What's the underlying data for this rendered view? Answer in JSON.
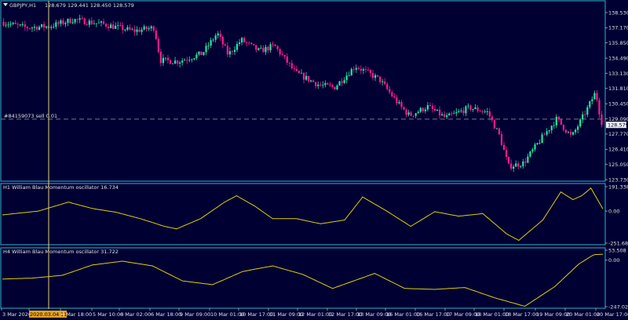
{
  "colors": {
    "background": "#000033",
    "frame": "#2fb3c9",
    "bull": "#26e6a0",
    "bear": "#ff1a8c",
    "text": "#e0e0e0",
    "oscillator": "#e0d000",
    "crosshair": "#e6d27a",
    "price_tag_bg": "#f0f0f0",
    "price_tag_fg": "#000033",
    "date_tag_bg": "#e8a317",
    "order_line": "#7a7a7a"
  },
  "header": {
    "triangle_icon": "triangle-down-icon",
    "symbol": "GBPJPY,H1",
    "ohlc": "128.679 129.441 128.450 128.579"
  },
  "order_label": "#84159073 sell 0.01",
  "current_price_label": "128.579",
  "cursor_date_label": "2020.03.04 11:00",
  "chart_data": [
    {
      "type": "candlestick",
      "title": "GBPJPY,H1",
      "y_ticks": [
        "138.530",
        "137.170",
        "135.850",
        "134.490",
        "133.130",
        "131.810",
        "130.450",
        "129.090",
        "127.770",
        "126.410",
        "125.050",
        "123.730"
      ],
      "ylim": [
        123.73,
        138.53
      ],
      "current_price": 128.579,
      "order_price": 129.09,
      "key_points": [
        {
          "t": 0,
          "v": 137.7
        },
        {
          "t": 0.04,
          "v": 137.2
        },
        {
          "t": 0.08,
          "v": 137.3
        },
        {
          "t": 0.12,
          "v": 137.9
        },
        {
          "t": 0.17,
          "v": 137.5
        },
        {
          "t": 0.22,
          "v": 136.9
        },
        {
          "t": 0.255,
          "v": 137.2
        },
        {
          "t": 0.265,
          "v": 134.3
        },
        {
          "t": 0.295,
          "v": 134.2
        },
        {
          "t": 0.335,
          "v": 134.9
        },
        {
          "t": 0.36,
          "v": 136.7
        },
        {
          "t": 0.378,
          "v": 134.8
        },
        {
          "t": 0.4,
          "v": 136.1
        },
        {
          "t": 0.43,
          "v": 135.1
        },
        {
          "t": 0.455,
          "v": 135.6
        },
        {
          "t": 0.49,
          "v": 133.2
        },
        {
          "t": 0.53,
          "v": 132.1
        },
        {
          "t": 0.555,
          "v": 131.9
        },
        {
          "t": 0.59,
          "v": 133.8
        },
        {
          "t": 0.63,
          "v": 132.6
        },
        {
          "t": 0.665,
          "v": 130.2
        },
        {
          "t": 0.68,
          "v": 129.4
        },
        {
          "t": 0.71,
          "v": 130.2
        },
        {
          "t": 0.74,
          "v": 129.2
        },
        {
          "t": 0.78,
          "v": 130.1
        },
        {
          "t": 0.81,
          "v": 129.7
        },
        {
          "t": 0.83,
          "v": 127.6
        },
        {
          "t": 0.845,
          "v": 124.9
        },
        {
          "t": 0.87,
          "v": 125.2
        },
        {
          "t": 0.9,
          "v": 127.4
        },
        {
          "t": 0.925,
          "v": 129.1
        },
        {
          "t": 0.95,
          "v": 127.5
        },
        {
          "t": 0.975,
          "v": 129.9
        },
        {
          "t": 0.99,
          "v": 131.5
        },
        {
          "t": 1.0,
          "v": 128.6
        }
      ]
    },
    {
      "type": "line",
      "title": "H1 William Blau Momentum oscillator 16.734",
      "y_ticks": [
        "191.338",
        "0.00",
        "-251.686"
      ],
      "ylim": [
        -251.686,
        191.338
      ],
      "last_value": 16.734,
      "key_points": [
        {
          "t": 0,
          "v": -30
        },
        {
          "t": 0.06,
          "v": 0
        },
        {
          "t": 0.11,
          "v": 70
        },
        {
          "t": 0.15,
          "v": 20
        },
        {
          "t": 0.19,
          "v": -10
        },
        {
          "t": 0.23,
          "v": -60
        },
        {
          "t": 0.27,
          "v": -120
        },
        {
          "t": 0.29,
          "v": -140
        },
        {
          "t": 0.33,
          "v": -60
        },
        {
          "t": 0.37,
          "v": 70
        },
        {
          "t": 0.39,
          "v": 120
        },
        {
          "t": 0.42,
          "v": 40
        },
        {
          "t": 0.45,
          "v": -60
        },
        {
          "t": 0.49,
          "v": -60
        },
        {
          "t": 0.53,
          "v": -100
        },
        {
          "t": 0.57,
          "v": -70
        },
        {
          "t": 0.6,
          "v": 110
        },
        {
          "t": 0.64,
          "v": 0
        },
        {
          "t": 0.68,
          "v": -120
        },
        {
          "t": 0.72,
          "v": -5
        },
        {
          "t": 0.76,
          "v": -40
        },
        {
          "t": 0.8,
          "v": -20
        },
        {
          "t": 0.84,
          "v": -180
        },
        {
          "t": 0.86,
          "v": -230
        },
        {
          "t": 0.9,
          "v": -70
        },
        {
          "t": 0.93,
          "v": 150
        },
        {
          "t": 0.95,
          "v": 90
        },
        {
          "t": 0.965,
          "v": 120
        },
        {
          "t": 0.98,
          "v": 180
        },
        {
          "t": 1.0,
          "v": 16.734
        }
      ]
    },
    {
      "type": "line",
      "title": "H4 William Blau Momentum oscillator 31.722",
      "y_ticks": [
        "53.508",
        "0.00",
        "-247.025"
      ],
      "ylim": [
        -247.025,
        53.508
      ],
      "last_value": 31.722,
      "key_points": [
        {
          "t": 0,
          "v": -100
        },
        {
          "t": 0.05,
          "v": -95
        },
        {
          "t": 0.1,
          "v": -80
        },
        {
          "t": 0.15,
          "v": -25
        },
        {
          "t": 0.2,
          "v": -5
        },
        {
          "t": 0.25,
          "v": -30
        },
        {
          "t": 0.3,
          "v": -110
        },
        {
          "t": 0.35,
          "v": -130
        },
        {
          "t": 0.4,
          "v": -60
        },
        {
          "t": 0.45,
          "v": -30
        },
        {
          "t": 0.5,
          "v": -75
        },
        {
          "t": 0.55,
          "v": -150
        },
        {
          "t": 0.62,
          "v": -70
        },
        {
          "t": 0.67,
          "v": -150
        },
        {
          "t": 0.72,
          "v": -155
        },
        {
          "t": 0.77,
          "v": -145
        },
        {
          "t": 0.82,
          "v": -200
        },
        {
          "t": 0.87,
          "v": -245
        },
        {
          "t": 0.92,
          "v": -140
        },
        {
          "t": 0.96,
          "v": -20
        },
        {
          "t": 0.985,
          "v": 30
        },
        {
          "t": 1.0,
          "v": 31.722
        }
      ]
    }
  ],
  "x_ticks": [
    "3 Mar 2020",
    "2020.03.04 11:00",
    "4 Mar 18:00",
    "5 Mar 10:00",
    "6 Mar 02:00",
    "6 Mar 18:00",
    "9 Mar 09:00",
    "10 Mar 01:00",
    "10 Mar 17:00",
    "11 Mar 09:00",
    "12 Mar 01:00",
    "12 Mar 17:00",
    "13 Mar 09:00",
    "16 Mar 01:00",
    "16 Mar 17:00",
    "17 Mar 09:00",
    "18 Mar 01:00",
    "18 Mar 17:00",
    "19 Mar 09:00",
    "20 Mar 01:00",
    "20 Mar 17:00"
  ]
}
